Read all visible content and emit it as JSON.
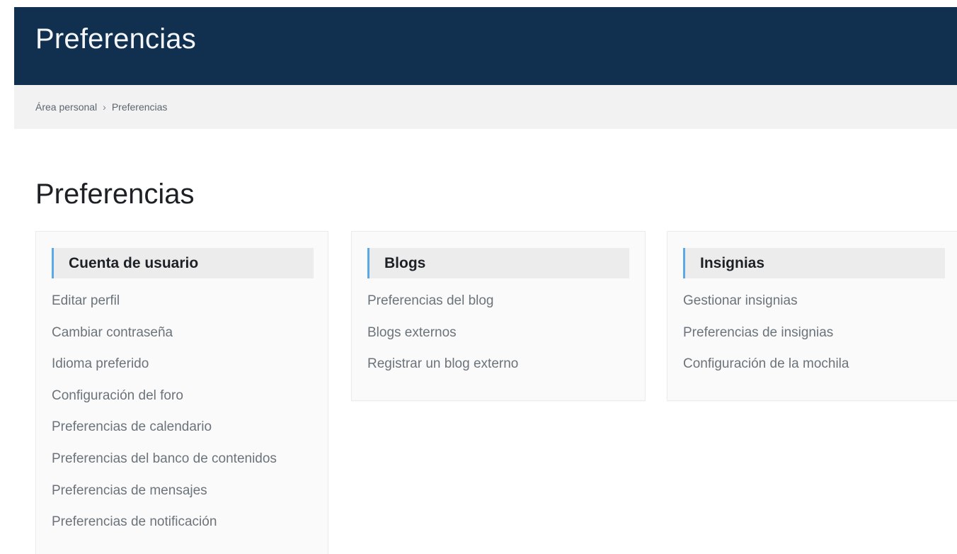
{
  "header": {
    "title": "Preferencias"
  },
  "breadcrumb": {
    "items": [
      "Área personal",
      "Preferencias"
    ],
    "separator": "›"
  },
  "main": {
    "heading": "Preferencias",
    "cards": [
      {
        "title": "Cuenta de usuario",
        "links": [
          "Editar perfil",
          "Cambiar contraseña",
          "Idioma preferido",
          "Configuración del foro",
          "Preferencias de calendario",
          "Preferencias del banco de contenidos",
          "Preferencias de mensajes",
          "Preferencias de notificación"
        ]
      },
      {
        "title": "Blogs",
        "links": [
          "Preferencias del blog",
          "Blogs externos",
          "Registrar un blog externo"
        ]
      },
      {
        "title": "Insignias",
        "links": [
          "Gestionar insignias",
          "Preferencias de insignias",
          "Configuración de la mochila"
        ]
      }
    ]
  },
  "colors": {
    "header_bg": "#11304f",
    "accent": "#5aa9e6",
    "breadcrumb_bg": "#f2f2f2"
  }
}
